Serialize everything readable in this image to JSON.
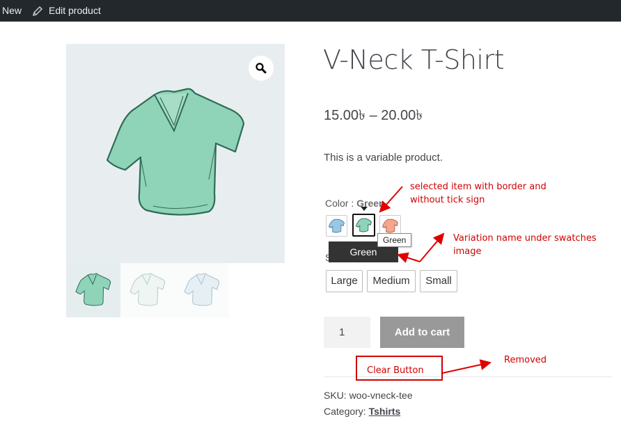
{
  "adminbar": {
    "new_label": "New",
    "edit_label": "Edit product"
  },
  "product": {
    "title": "V-Neck T-Shirt",
    "price": "15.00৳  – 20.00৳",
    "description": "This is a variable product.",
    "color_label": "Color : ",
    "color_value": "Green",
    "swatches": [
      "blue",
      "green",
      "pink"
    ],
    "tooltip_small": "Green",
    "tooltip_name": "Green",
    "size_label_partial": "S",
    "sizes": [
      "Large",
      "Medium",
      "Small"
    ],
    "quantity": "1",
    "add_to_cart": "Add to cart",
    "sku_text": "SKU: woo-vneck-tee",
    "category_label": "Category: ",
    "category_value": "Tshirts"
  },
  "annotations": {
    "selected_line1": "selected item with border and",
    "selected_line2": "without tick sign",
    "variation_line1": "Variation name under swatches",
    "variation_line2": "image",
    "clear_button": "Clear Button",
    "removed": "Removed"
  },
  "colors": {
    "annotation": "#d00000",
    "shirt_green": "#8fd4b8",
    "admin_bar": "#23282d"
  },
  "icons": {
    "edit": "pencil-icon",
    "zoom": "magnifier-icon"
  }
}
